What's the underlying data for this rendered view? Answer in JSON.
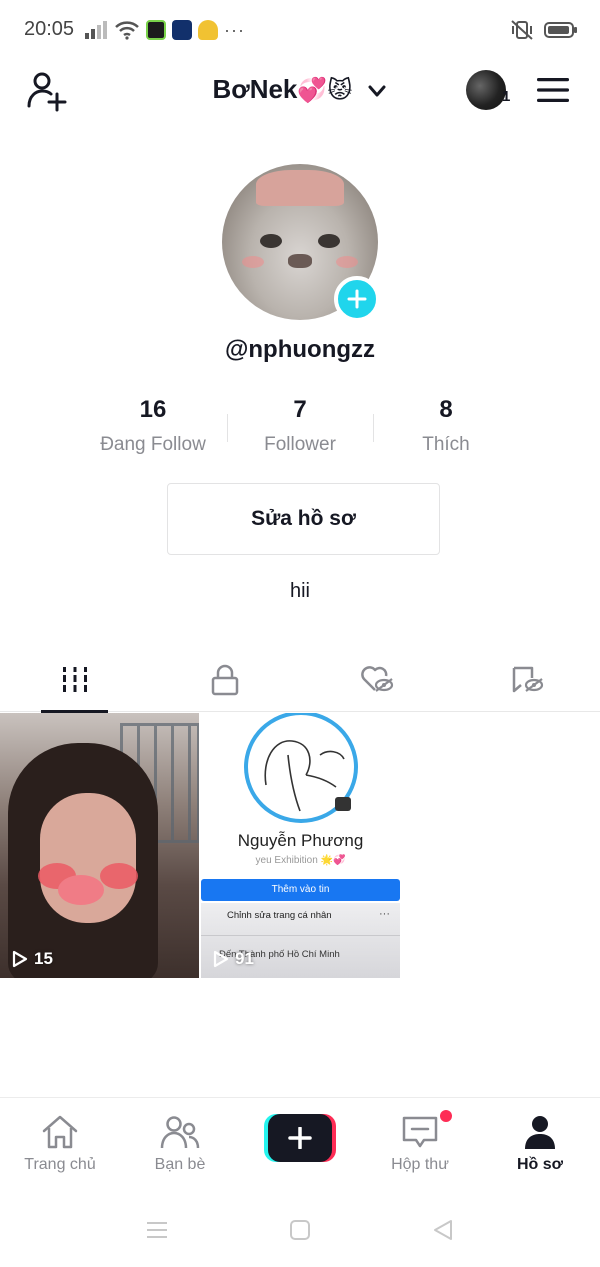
{
  "status_bar": {
    "time": "20:05",
    "dots": "···"
  },
  "header": {
    "title": "BơNek",
    "title_emoji": "💞😾",
    "notification_count": "1"
  },
  "profile": {
    "username": "@nphuongzz",
    "stats": [
      {
        "value": "16",
        "label": "Đang Follow"
      },
      {
        "value": "7",
        "label": "Follower"
      },
      {
        "value": "8",
        "label": "Thích"
      }
    ],
    "edit_button": "Sửa hồ sơ",
    "bio": "hii"
  },
  "videos": [
    {
      "views": "15"
    },
    {
      "views": "91",
      "screenshot_name": "Nguyễn Phương",
      "screenshot_subtitle": "yeu Exhibition 🌟💞",
      "screenshot_button": "Thêm vào tin",
      "screenshot_edit": "Chỉnh sửa trang cá nhân",
      "screenshot_dots": "···",
      "screenshot_location": "Đến Thành phố Hồ Chí Minh"
    }
  ],
  "bottom_nav": [
    {
      "label": "Trang chủ",
      "icon": "home-icon"
    },
    {
      "label": "Bạn bè",
      "icon": "friends-icon"
    },
    {
      "label": "",
      "icon": "plus-icon"
    },
    {
      "label": "Hộp thư",
      "icon": "inbox-icon"
    },
    {
      "label": "Hồ sơ",
      "icon": "profile-icon"
    }
  ],
  "colors": {
    "accent_cyan": "#20d5ec",
    "brand_red": "#fe2c55",
    "text_primary": "#161823",
    "text_secondary": "#8a8b91"
  }
}
